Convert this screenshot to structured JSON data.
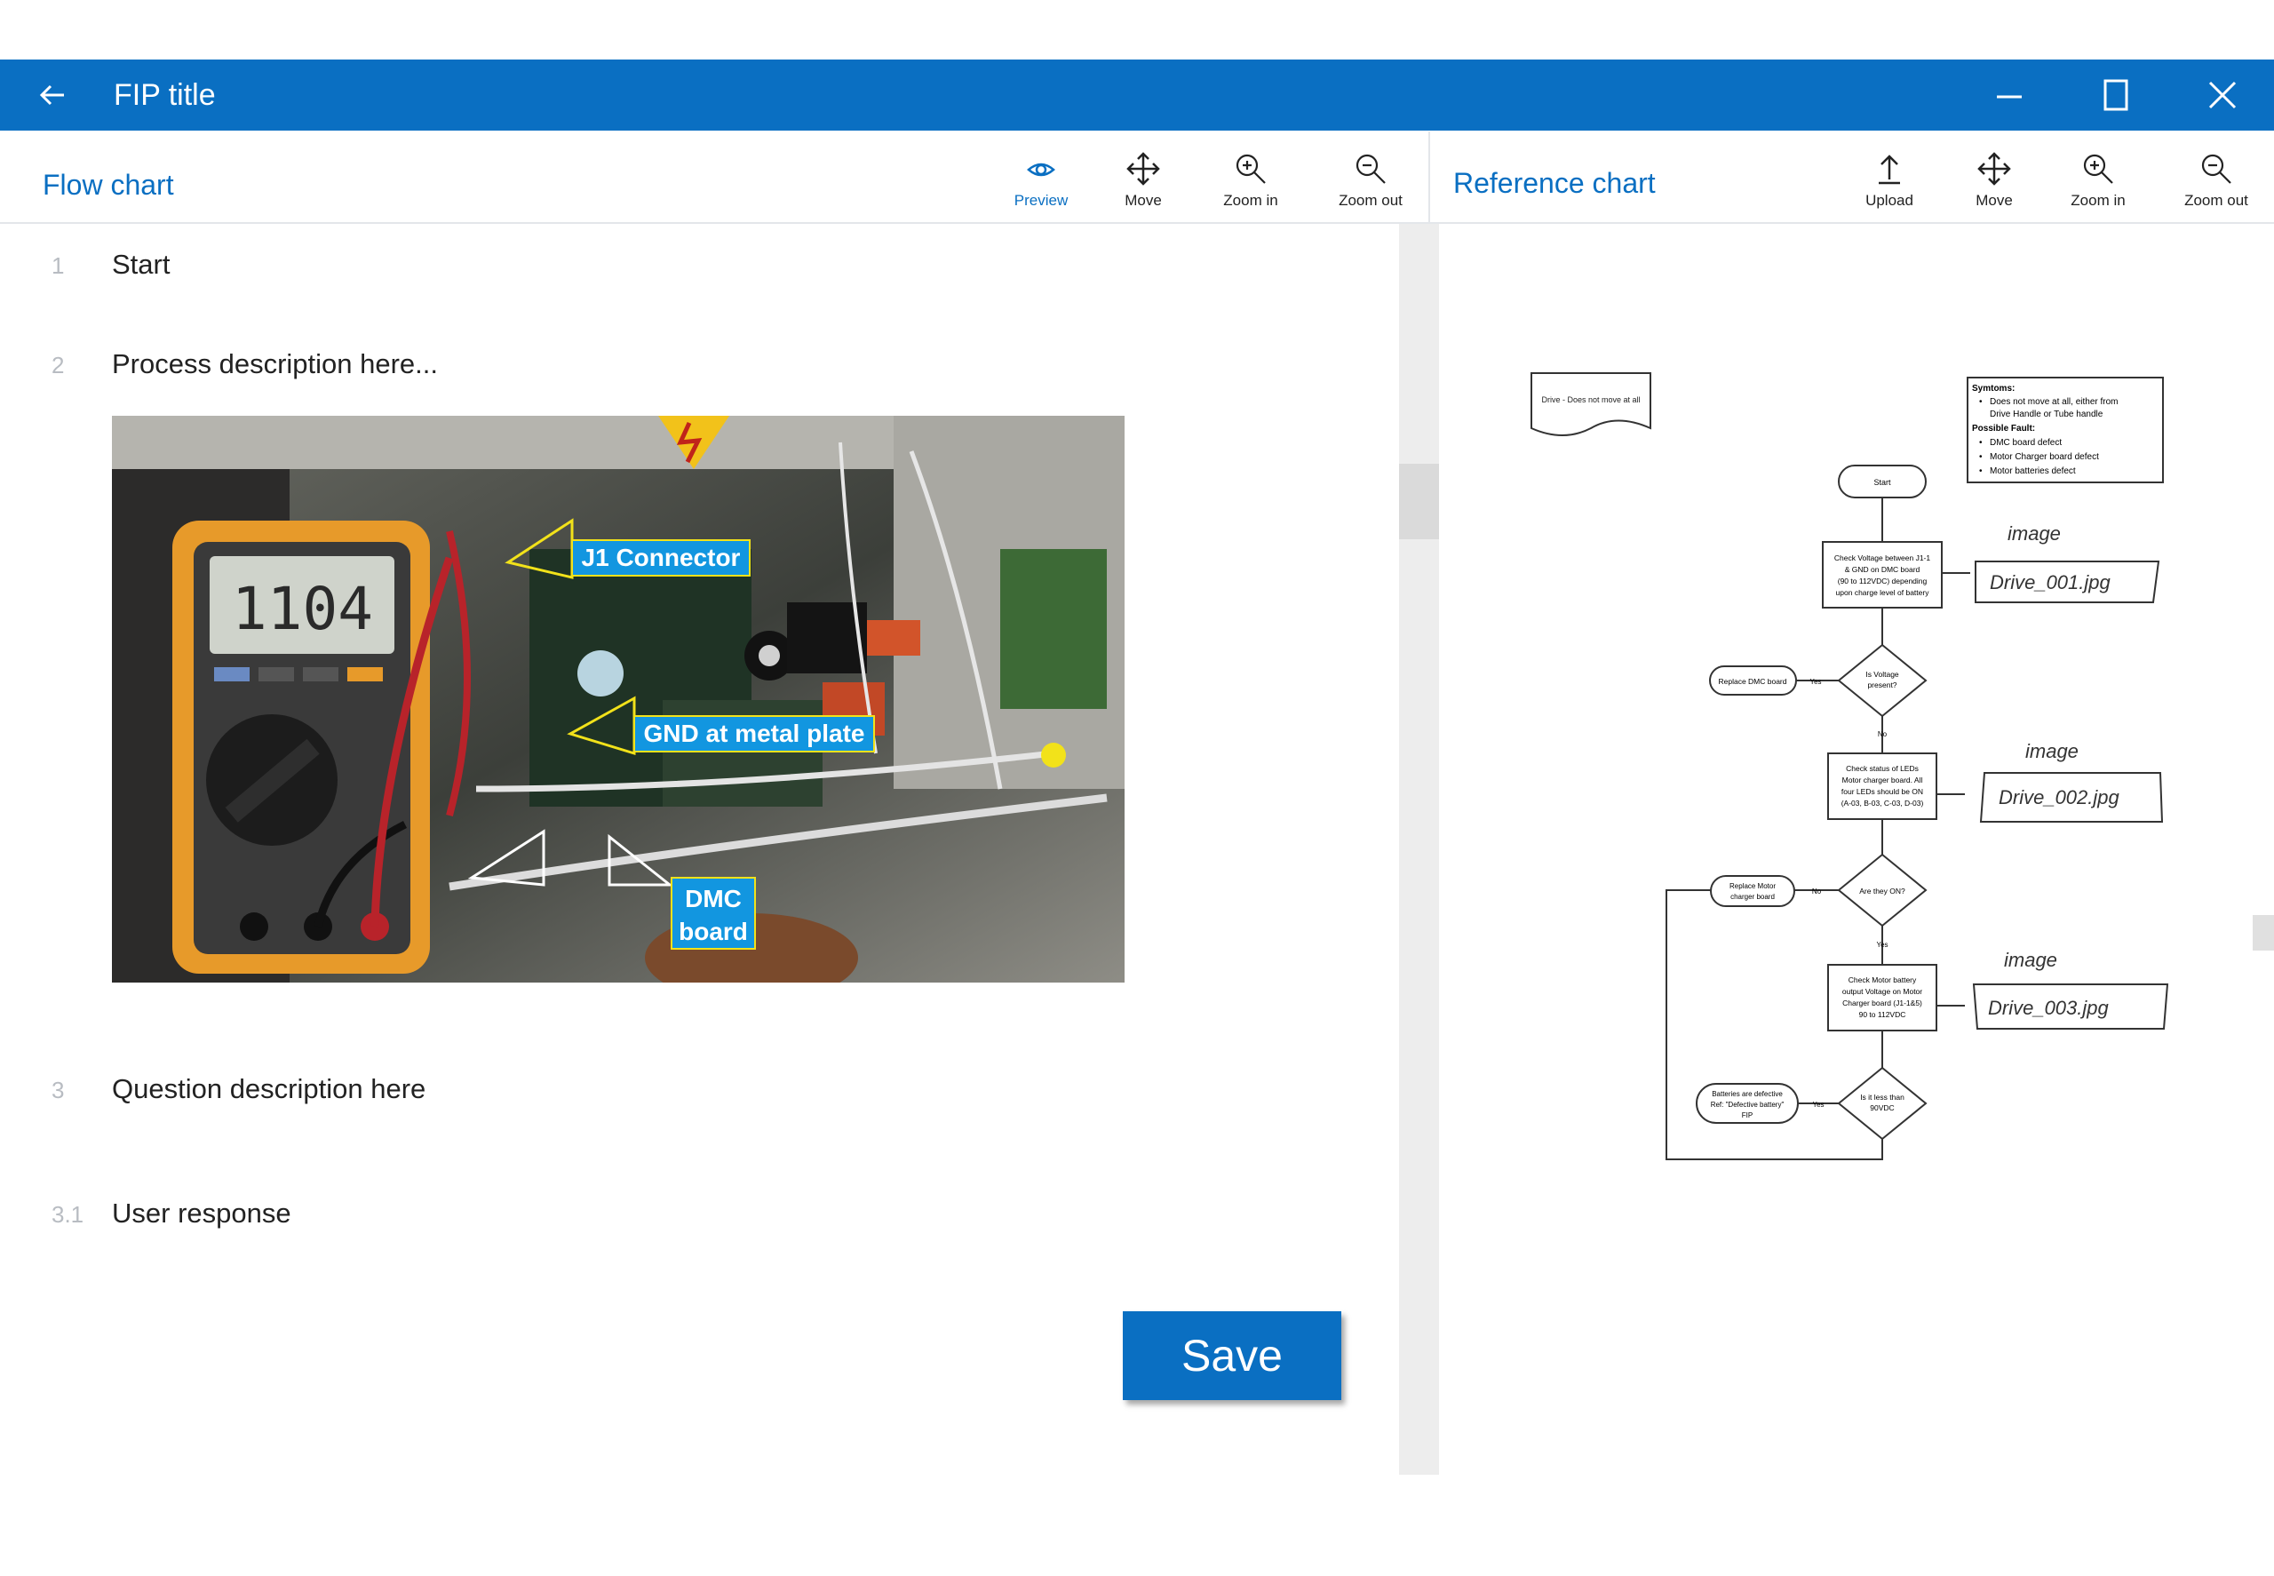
{
  "window": {
    "title": "FIP title",
    "icons": [
      "back-arrow-icon",
      "minimize-icon",
      "maximize-icon",
      "close-icon"
    ]
  },
  "flow_panel": {
    "heading": "Flow chart",
    "tools": [
      {
        "label": "Preview",
        "icon": "eye-icon",
        "active": true
      },
      {
        "label": "Move",
        "icon": "move-icon"
      },
      {
        "label": "Zoom in",
        "icon": "zoom-in-icon"
      },
      {
        "label": "Zoom out",
        "icon": "zoom-out-icon"
      }
    ],
    "steps": [
      {
        "num": "1",
        "text": "Start"
      },
      {
        "num": "2",
        "text": "Process description here..."
      },
      {
        "num": "3",
        "text": "Question description here"
      },
      {
        "num": "3.1",
        "text": "User response"
      }
    ],
    "photo_labels": {
      "j1": "J1 Connector",
      "gnd": "GND at metal plate",
      "dmc_1": "DMC",
      "dmc_2": "board"
    },
    "save_label": "Save"
  },
  "reference_panel": {
    "heading": "Reference chart",
    "tools": [
      {
        "label": "Upload",
        "icon": "upload-icon"
      },
      {
        "label": "Move",
        "icon": "move-icon"
      },
      {
        "label": "Zoom in",
        "icon": "zoom-in-icon"
      },
      {
        "label": "Zoom out",
        "icon": "zoom-out-icon"
      }
    ],
    "chart": {
      "doc_title": "Drive - Does not move at all",
      "symptoms_title": "Symtoms:",
      "symptom_1a": "Does not move at all, either from",
      "symptom_1b": "Drive Handle or Tube handle",
      "fault_title": "Possible Fault:",
      "fault_1": "DMC board defect",
      "fault_2": "Motor Charger board defect",
      "fault_3": "Motor batteries defect",
      "start": "Start",
      "check1_a": "Check Voltage between J1-1",
      "check1_b": "& GND on DMC board",
      "check1_c": "(90 to 112VDC) depending",
      "check1_d": "upon charge level of battery",
      "decision1_a": "Is Voltage",
      "decision1_b": "present?",
      "replace_dmc": "Replace DMC board",
      "yes": "Yes",
      "no": "No",
      "check2_a": "Check status of LEDs",
      "check2_b": "Motor charger board. All",
      "check2_c": "four LEDs should be ON",
      "check2_d": "(A-03, B-03, C-03, D-03)",
      "decision2": "Are they ON?",
      "replace_motor_a": "Replace Motor",
      "replace_motor_b": "charger board",
      "check3_a": "Check Motor battery",
      "check3_b": "output Voltage on Motor",
      "check3_c": "Charger board (J1-1&5)",
      "check3_d": "90 to 112VDC",
      "decision3_a": "Is it less than",
      "decision3_b": "90VDC",
      "battery_a": "Batteries are defective",
      "battery_b": "Ref: \"Defective battery\"",
      "battery_c": "FIP",
      "note_word": "image",
      "note_1": "Drive_001.jpg",
      "note_2": "Drive_002.jpg",
      "note_3": "Drive_003.jpg"
    }
  },
  "colors": {
    "accent": "#0a6fc2",
    "label_bg": "#1296e0",
    "label_border": "#f2e21a"
  }
}
